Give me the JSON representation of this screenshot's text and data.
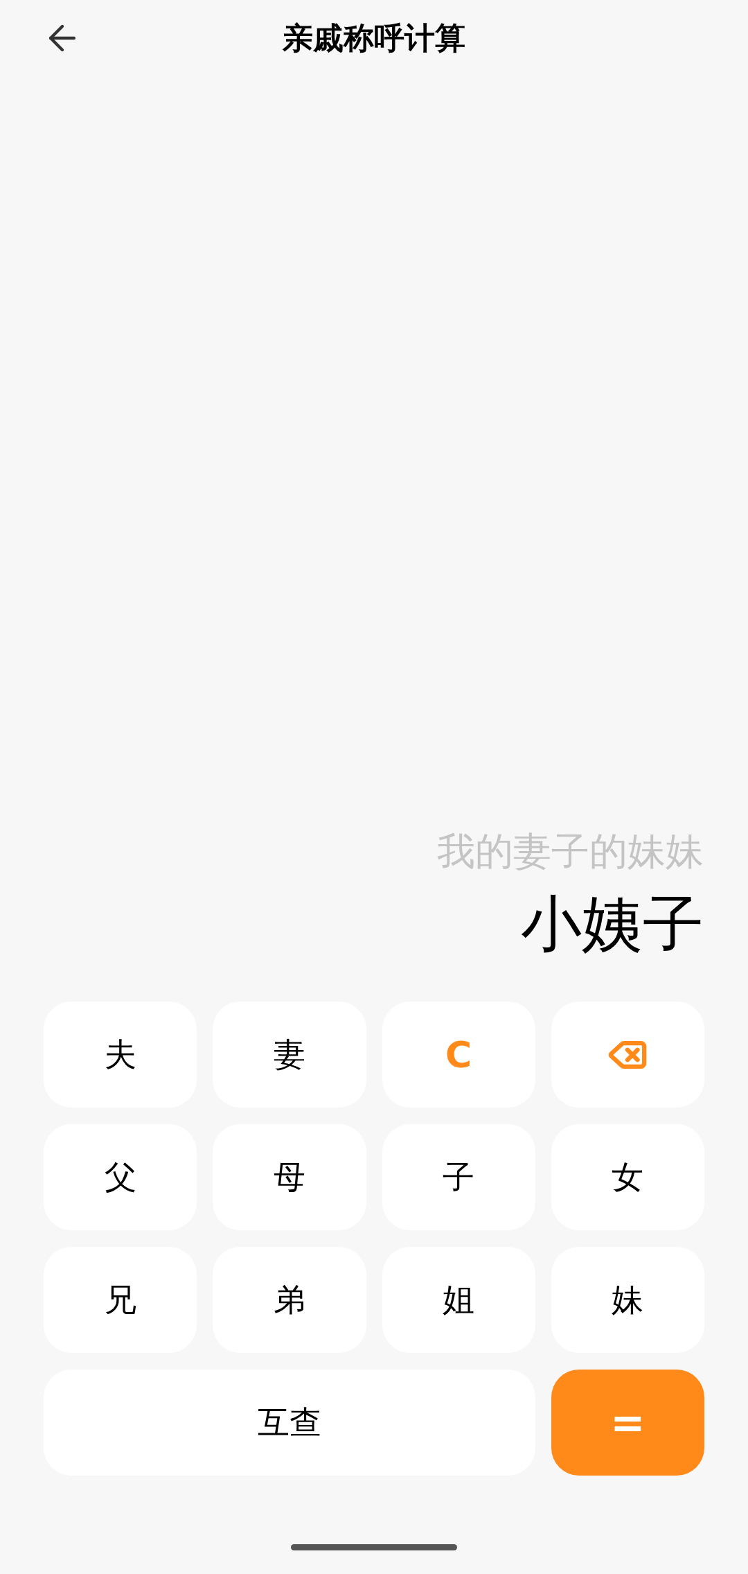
{
  "header": {
    "title": "亲戚称呼计算"
  },
  "display": {
    "expression": "我的妻子的妹妹",
    "result": "小姨子"
  },
  "keys": [
    {
      "kind": "relation",
      "label": "夫"
    },
    {
      "kind": "relation",
      "label": "妻"
    },
    {
      "kind": "clear",
      "label": "C"
    },
    {
      "kind": "backspace"
    },
    {
      "kind": "relation",
      "label": "父"
    },
    {
      "kind": "relation",
      "label": "母"
    },
    {
      "kind": "relation",
      "label": "子"
    },
    {
      "kind": "relation",
      "label": "女"
    },
    {
      "kind": "relation",
      "label": "兄"
    },
    {
      "kind": "relation",
      "label": "弟"
    },
    {
      "kind": "relation",
      "label": "姐"
    },
    {
      "kind": "relation",
      "label": "妹"
    },
    {
      "kind": "swap",
      "label": "互查"
    },
    {
      "kind": "equals",
      "label": "="
    }
  ]
}
